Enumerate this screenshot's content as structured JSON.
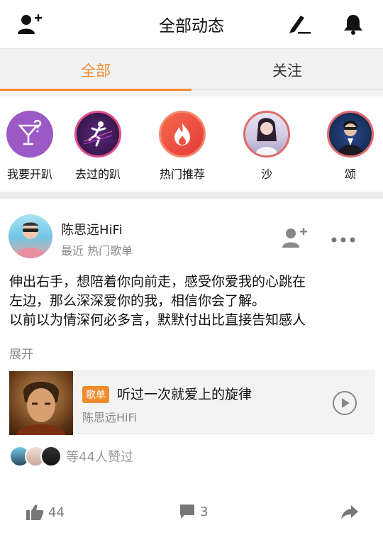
{
  "header": {
    "title": "全部动态"
  },
  "tabs": [
    {
      "label": "全部"
    },
    {
      "label": "关注"
    }
  ],
  "stories": [
    {
      "label": "我要开趴"
    },
    {
      "label": "去过的趴"
    },
    {
      "label": "热门推荐"
    },
    {
      "label": "沙"
    },
    {
      "label": "颂"
    }
  ],
  "post": {
    "author": "陈思远HiFi",
    "meta": "最近 热门歌单",
    "content_lines": [
      "伸出右手，想陪着你向前走，感受你爱我的心跳在",
      "左边，那么深深爱你的我，相信你会了解。",
      "以前以为情深何必多言，默默付出比直接告知感人"
    ],
    "expand": "展开",
    "card": {
      "badge": "歌单",
      "title": "听过一次就爱上的旋律",
      "artist": "陈思远HiFi"
    },
    "likes_text": "等44人赞过",
    "like_count": "44",
    "comment_count": "3"
  },
  "colors": {
    "accent": "#f08b2e",
    "text": "#222222",
    "muted": "#888888"
  }
}
